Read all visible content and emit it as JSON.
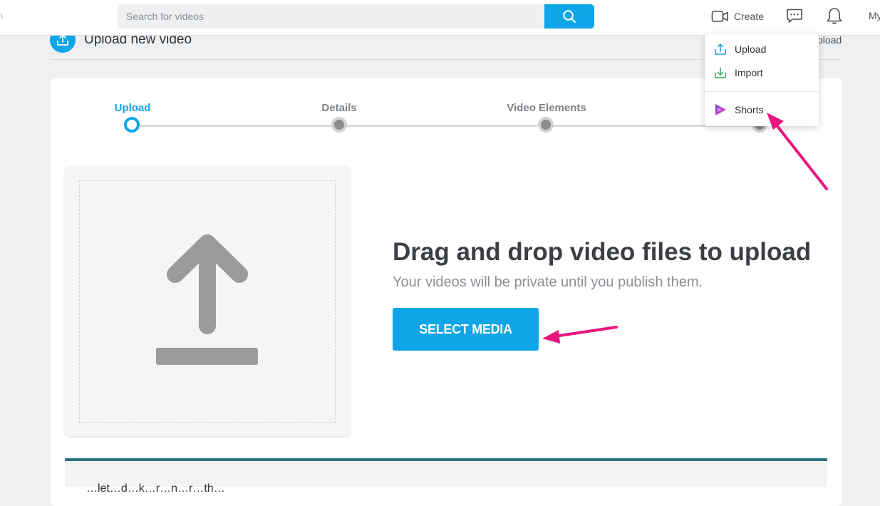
{
  "topbar": {
    "logo_fragment": "n",
    "search_placeholder": "Search for videos",
    "create_label": "Create",
    "my_label": "My"
  },
  "header": {
    "title": "Upload new video",
    "right_fragment": "pload"
  },
  "stepper": {
    "steps": [
      {
        "label": "Upload",
        "active": true
      },
      {
        "label": "Details",
        "active": false
      },
      {
        "label": "Video Elements",
        "active": false
      },
      {
        "label": "",
        "active": false
      }
    ]
  },
  "upload": {
    "title": "Drag and drop video files to upload",
    "subtitle": "Your videos will be private until you publish them.",
    "button_label": "SELECT MEDIA"
  },
  "bottom": {
    "text": "…let…d…k…r…n…r…th…"
  },
  "dropdown": {
    "items": [
      {
        "label": "Upload",
        "icon": "upload-cloud-icon"
      },
      {
        "label": "Import",
        "icon": "import-download-icon"
      },
      {
        "label": "Shorts",
        "icon": "shorts-play-icon"
      }
    ]
  },
  "colors": {
    "accent": "#0ea5e9",
    "annotation": "#e8157f",
    "shorts_gradient_start": "#7b3fe4",
    "shorts_gradient_end": "#e64ca8"
  }
}
